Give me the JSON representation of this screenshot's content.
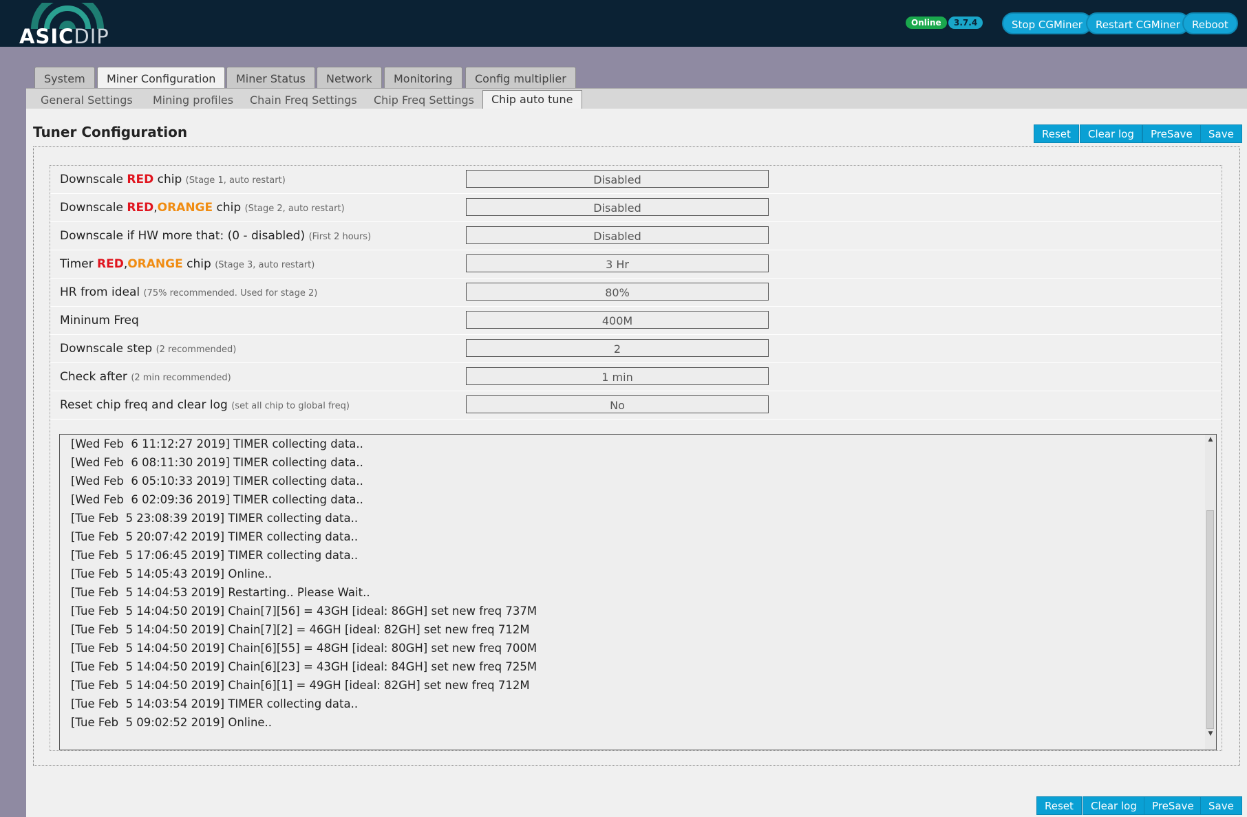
{
  "header": {
    "logo_text_1": "ASIC",
    "logo_text_2": "DIP",
    "status_badge": "Online",
    "version_badge": "3.7.4",
    "buttons": {
      "stop": "Stop CGMiner",
      "restart": "Restart CGMiner",
      "reboot": "Reboot"
    }
  },
  "tabs": [
    "System",
    "Miner Configuration",
    "Miner Status",
    "Network",
    "Monitoring",
    "Config multiplier"
  ],
  "subtabs": [
    "General Settings",
    "Mining profiles",
    "Chain Freq Settings",
    "Chip Freq Settings",
    "Chip auto tune"
  ],
  "panel": {
    "title": "Tuner Configuration",
    "actions": {
      "reset": "Reset",
      "clear_log": "Clear log",
      "presave": "PreSave",
      "save": "Save"
    }
  },
  "settings": [
    {
      "pre": "Downscale ",
      "red": "RED",
      "sep": "",
      "orange": "",
      "post": " chip ",
      "hint": "(Stage 1, auto restart)",
      "value": "Disabled"
    },
    {
      "pre": "Downscale ",
      "red": "RED",
      "sep": ",",
      "orange": "ORANGE",
      "post": " chip ",
      "hint": "(Stage 2, auto restart)",
      "value": "Disabled"
    },
    {
      "pre": "Downscale if HW more that: (0 - disabled) ",
      "red": "",
      "sep": "",
      "orange": "",
      "post": "",
      "hint": "(First 2 hours)",
      "value": "Disabled"
    },
    {
      "pre": "Timer ",
      "red": "RED",
      "sep": ",",
      "orange": "ORANGE",
      "post": " chip ",
      "hint": "(Stage 3, auto restart)",
      "value": "3 Hr"
    },
    {
      "pre": "HR from ideal ",
      "red": "",
      "sep": "",
      "orange": "",
      "post": "",
      "hint": "(75% recommended. Used for stage 2)",
      "value": "80%"
    },
    {
      "pre": "Mininum Freq",
      "red": "",
      "sep": "",
      "orange": "",
      "post": "",
      "hint": "",
      "value": "400M"
    },
    {
      "pre": "Downscale step ",
      "red": "",
      "sep": "",
      "orange": "",
      "post": "",
      "hint": "(2 recommended)",
      "value": "2"
    },
    {
      "pre": "Check after ",
      "red": "",
      "sep": "",
      "orange": "",
      "post": "",
      "hint": "(2 min recommended)",
      "value": "1 min"
    },
    {
      "pre": "Reset chip freq and clear log ",
      "red": "",
      "sep": "",
      "orange": "",
      "post": "",
      "hint": "(set all chip to global freq)",
      "value": "No"
    }
  ],
  "log": [
    "[Wed Feb  6 11:12:27 2019] TIMER collecting data..",
    "[Wed Feb  6 08:11:30 2019] TIMER collecting data..",
    "[Wed Feb  6 05:10:33 2019] TIMER collecting data..",
    "[Wed Feb  6 02:09:36 2019] TIMER collecting data..",
    "[Tue Feb  5 23:08:39 2019] TIMER collecting data..",
    "[Tue Feb  5 20:07:42 2019] TIMER collecting data..",
    "[Tue Feb  5 17:06:45 2019] TIMER collecting data..",
    "[Tue Feb  5 14:05:43 2019] Online..",
    "[Tue Feb  5 14:04:53 2019] Restarting.. Please Wait..",
    "[Tue Feb  5 14:04:50 2019] Chain[7][56] = 43GH [ideal: 86GH] set new freq 737M",
    "[Tue Feb  5 14:04:50 2019] Chain[7][2] = 46GH [ideal: 82GH] set new freq 712M",
    "[Tue Feb  5 14:04:50 2019] Chain[6][55] = 48GH [ideal: 80GH] set new freq 700M",
    "[Tue Feb  5 14:04:50 2019] Chain[6][23] = 43GH [ideal: 84GH] set new freq 725M",
    "[Tue Feb  5 14:04:50 2019] Chain[6][1] = 49GH [ideal: 82GH] set new freq 712M",
    "[Tue Feb  5 14:03:54 2019] TIMER collecting data..",
    "[Tue Feb  5 09:02:52 2019] Online.."
  ],
  "colors": {
    "header_bg": "#0b2234",
    "accent": "#0aa0d4",
    "red": "#e0141e",
    "orange": "#f08c12",
    "online": "#1aa84d"
  }
}
